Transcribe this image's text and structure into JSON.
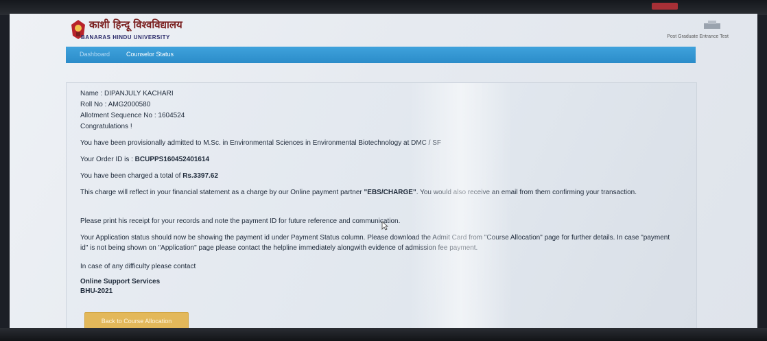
{
  "header": {
    "logo_hindi": "काशी हिन्दू विश्वविद्यालय",
    "logo_english": "BANARAS HINDU UNIVERSITY",
    "right_caption": "Post Graduate Entrance Test"
  },
  "nav": {
    "items": [
      {
        "label": "Dashboard"
      },
      {
        "label": "Counselor Status"
      }
    ]
  },
  "receipt": {
    "name": "Name : DIPANJULY KACHARI",
    "roll": "Roll No : AMG2000580",
    "allotment": "Allotment Sequence No : 1604524",
    "congrats": "Congratulations !",
    "admitted": "You have been provisionally admitted to M.Sc. in Environmental Sciences in Environmental Biotechnology at DMC / SF",
    "order_prefix": "Your Order ID is : ",
    "order_id": "BCUPPS160452401614",
    "charged_prefix": "You have been charged a total of ",
    "charged_amount": "Rs.3397.62",
    "statement_before": "This charge will reflect in your financial statement as a charge by our Online payment partner ",
    "statement_partner": "\"EBS/CHARGE\"",
    "statement_after": ". You would also receive an email from them confirming your transaction.",
    "print_note": "Please print his receipt for your records and note the payment ID for future reference and communication.",
    "status_note": "Your Application status should now be showing the payment id under Payment Status column. Please download the Admit Card from \"Course Allocation\" page for further details. In case \"payment id\" is not being shown on \"Application\" page please contact the helpline immediately alongwith evidence of admission fee payment.",
    "difficulty": "In case of any difficulty please contact",
    "support": "Online Support Services",
    "year": "BHU-2021",
    "back_button": "Back to Course Allocation"
  }
}
